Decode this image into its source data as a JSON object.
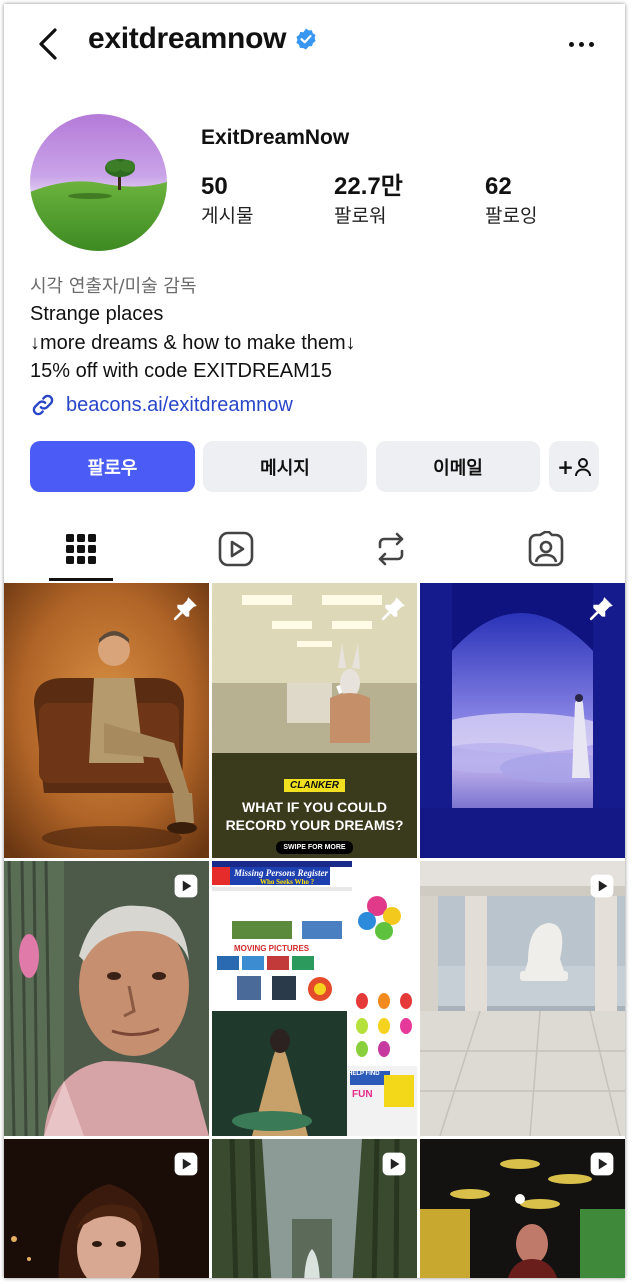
{
  "header": {
    "username": "exitdreamnow",
    "back_icon": "chevron-left-icon",
    "verified_icon": "verified-badge-icon",
    "more_icon": "more-horizontal-icon",
    "verified_color": "#3897f0"
  },
  "profile": {
    "display_name": "ExitDreamNow",
    "stats": [
      {
        "value": "50",
        "label": "게시물"
      },
      {
        "value": "22.7만",
        "label": "팔로워"
      },
      {
        "value": "62",
        "label": "팔로잉"
      }
    ],
    "category": "시각 연출자/미술 감독",
    "bio": [
      "Strange places",
      "↓more dreams & how to make them↓",
      "15% off with code EXITDREAM15"
    ],
    "link": "beacons.ai/exitdreamnow"
  },
  "actions": {
    "follow": "팔로우",
    "message": "메시지",
    "email": "이메일",
    "add_person": "+",
    "accent": "#4a5cf5"
  },
  "tabs": [
    {
      "name": "grid",
      "icon": "grid-icon",
      "active": true
    },
    {
      "name": "reels",
      "icon": "reels-icon",
      "active": false
    },
    {
      "name": "reposts",
      "icon": "repost-icon",
      "active": false
    },
    {
      "name": "tagged",
      "icon": "tagged-person-icon",
      "active": false
    }
  ],
  "posts": [
    {
      "badge": "pin-icon"
    },
    {
      "badge": "pin-icon",
      "caption_brand": "CLANKER",
      "caption_line1": "WHAT IF YOU COULD",
      "caption_line2": "RECORD YOUR DREAMS?",
      "caption_cta": "SWIPE FOR MORE"
    },
    {
      "badge": "pin-icon"
    },
    {
      "badge": "reel-icon"
    },
    {
      "badge": "carousel-icon",
      "title": "Missing Persons Register",
      "subtitle": "Who Seeks Who ?",
      "heading": "MOVING PICTURES",
      "help": "HELP FIND",
      "fun": "FUN"
    },
    {
      "badge": "reel-icon"
    },
    {
      "badge": "reel-icon"
    },
    {
      "badge": "reel-icon"
    },
    {
      "badge": "reel-icon"
    }
  ]
}
